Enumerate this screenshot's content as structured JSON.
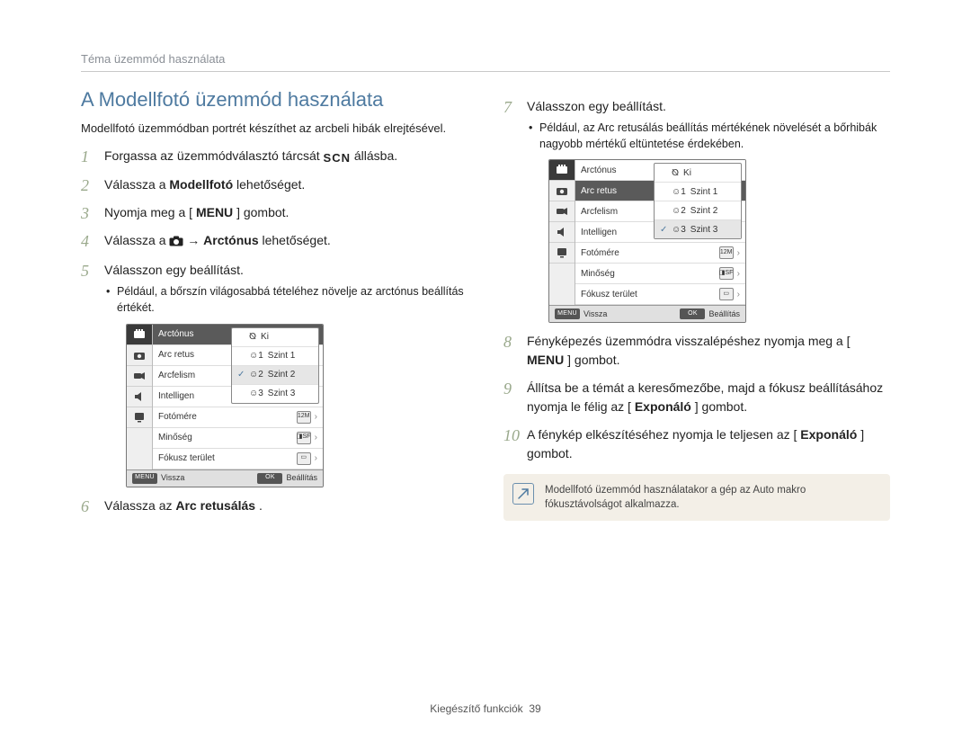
{
  "breadcrumb": "Téma üzemmód használata",
  "title": "A Modellfotó üzemmód használata",
  "intro": "Modellfotó üzemmódban portrét készíthet az arcbeli hibák elrejtésével.",
  "steps_left": {
    "s1_a": "Forgassa az üzemmódválasztó tárcsát ",
    "s1_b": " állásba.",
    "s2_a": "Válassza a ",
    "s2_b": "Modellfotó",
    "s2_c": " lehetőséget.",
    "s3_a": "Nyomja meg a [",
    "s3_b": "] gombot.",
    "s4_a": "Válassza a ",
    "s4_arrow": " → ",
    "s4_b": "Arctónus",
    "s4_c": " lehetőséget.",
    "s5": "Válasszon egy beállítást.",
    "s5_note": "Például, a bőrszín világosabbá tételéhez növelje az arctónus beállítás értékét.",
    "s6_a": "Válassza az ",
    "s6_b": "Arc retusálás",
    "s6_c": "."
  },
  "steps_right": {
    "s7": "Válasszon egy beállítást.",
    "s7_note": "Például, az Arc retusálás beállítás mértékének növelését a bőrhibák nagyobb mértékű eltüntetése érdekében.",
    "s8_a": "Fényképezés üzemmódra visszalépéshez nyomja meg a [",
    "s8_b": "] gombot.",
    "s9_a": "Állítsa be a témát a keresőmezőbe, majd a fókusz beállításához nyomja le félig az [",
    "s9_b": "Exponáló",
    "s9_c": "] gombot.",
    "s10_a": "A fénykép elkészítéséhez nyomja le teljesen az [",
    "s10_b": "Exponáló",
    "s10_c": "] gombot."
  },
  "note": "Modellfotó üzemmód használatakor a gép az Auto makro fókusztávolságot alkalmazza.",
  "lcd_common": {
    "rows": [
      {
        "label": "Arctónus"
      },
      {
        "label": "Arc retus"
      },
      {
        "label": "Arcfelism"
      },
      {
        "label": "Intelligen"
      },
      {
        "label": "Fotómére"
      },
      {
        "label": "Minőség"
      },
      {
        "label": "Fókusz terület"
      }
    ],
    "foot_back_label": "MENU",
    "foot_back": "Vissza",
    "foot_ok_label": "OK",
    "foot_ok": "Beállítás"
  },
  "lcd1_popup": {
    "items": [
      "Ki",
      "Szint 1",
      "Szint 2",
      "Szint 3"
    ],
    "selected": 2
  },
  "lcd2_popup": {
    "items": [
      "Ki",
      "Szint 1",
      "Szint 2",
      "Szint 3"
    ],
    "selected": 3
  },
  "footer_a": "Kiegészítő funkciók",
  "footer_b": "39",
  "icons": {
    "scn": "SCN",
    "menu": "MENU"
  }
}
